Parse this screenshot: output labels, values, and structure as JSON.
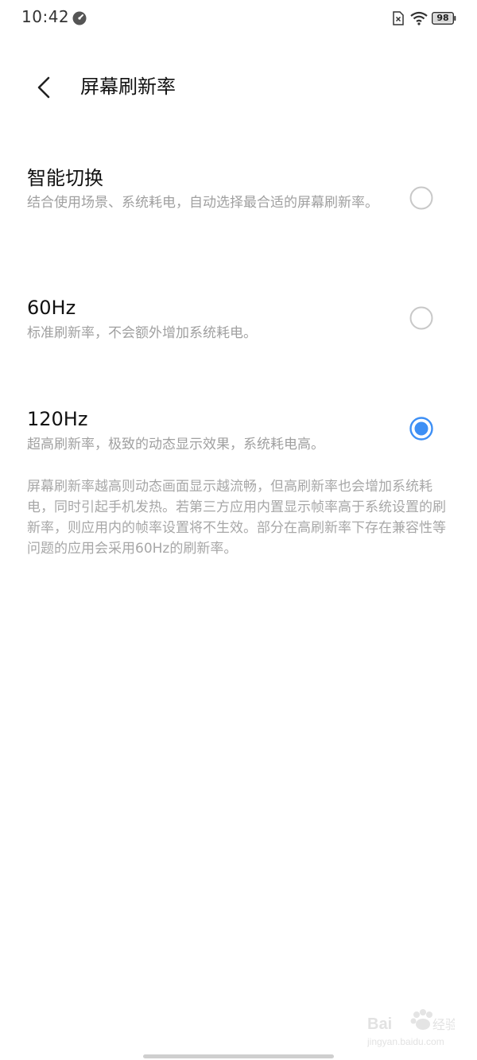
{
  "status_bar": {
    "time": "10:42",
    "battery_level": "98",
    "icons": [
      "gauge-icon",
      "sim-card-icon",
      "wifi-icon",
      "battery-icon"
    ]
  },
  "header": {
    "back_icon": "chevron-left-icon",
    "title": "屏幕刷新率"
  },
  "options": [
    {
      "title": "智能切换",
      "description": "结合使用场景、系统耗电，自动选择最合适的屏幕刷新率。",
      "selected": false
    },
    {
      "title": "60Hz",
      "description": "标准刷新率，不会额外增加系统耗电。",
      "selected": false
    },
    {
      "title": "120Hz",
      "description": "超高刷新率，极致的动态显示效果，系统耗电高。",
      "selected": true
    }
  ],
  "footer_note": "屏幕刷新率越高则动态画面显示越流畅，但高刷新率也会增加系统耗电，同时引起手机发热。若第三方应用内置显示帧率高于系统设置的刷新率，则应用内的帧率设置将不生效。部分在高刷新率下存在兼容性等问题的应用会采用60Hz的刷新率。",
  "colors": {
    "accent": "#3d8ff5",
    "radio_unselected": "#c8c8c8",
    "secondary_text": "#a0a0a0"
  }
}
